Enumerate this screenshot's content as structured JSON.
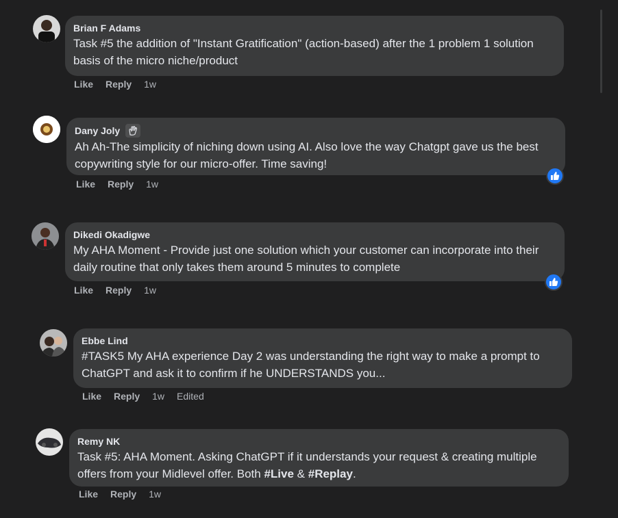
{
  "comments": [
    {
      "author": "Brian F Adams",
      "text": "Task #5 the addition of \"Instant Gratification\" (action-based) after the 1 problem 1 solution basis of the micro niche/product",
      "like": "Like",
      "reply": "Reply",
      "time": "1w"
    },
    {
      "author": "Dany Joly",
      "badge_icon": "waving-hand-icon",
      "text": "Ah Ah-The simplicity of niching down using AI. Also love the way Chatgpt gave us the best copywriting style for our micro-offer. Time saving!",
      "like": "Like",
      "reply": "Reply",
      "time": "1w",
      "reaction": "like-reaction-icon"
    },
    {
      "author": "Dikedi Okadigwe",
      "text": "My AHA Moment - Provide just one solution which your customer can incorporate into their daily routine that only takes them around 5 minutes to complete",
      "like": "Like",
      "reply": "Reply",
      "time": "1w",
      "reaction": "like-reaction-icon"
    },
    {
      "author": "Ebbe Lind",
      "text": "#TASK5 My AHA experience Day 2 was understanding the right way to make a prompt to ChatGPT and ask it to confirm if he UNDERSTANDS you...",
      "like": "Like",
      "reply": "Reply",
      "time": "1w",
      "edited": "Edited"
    },
    {
      "author": "Remy NK",
      "text_pre": "Task #5: AHA Moment. Asking ChatGPT if it understands your request & creating multiple offers from your Midlevel offer. Both ",
      "tag1": "#Live",
      "text_mid": " & ",
      "tag2": "#Replay",
      "text_post": ".",
      "like": "Like",
      "reply": "Reply",
      "time": "1w"
    }
  ],
  "colors": {
    "background": "#1f1f20",
    "bubble": "#3a3b3c",
    "text": "#e4e6eb",
    "meta": "#b0b3b8",
    "like_blue": "#2078f4"
  }
}
